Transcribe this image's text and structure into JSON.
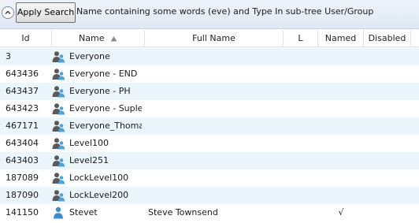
{
  "search": {
    "apply_label": "Apply Search",
    "criteria_text": "Name containing some words (eve) and Type In sub-tree User/Group"
  },
  "columns": {
    "id": "Id",
    "name": "Name",
    "full_name": "Full Name",
    "l": "L",
    "named": "Named",
    "disabled": "Disabled"
  },
  "sort": {
    "column": "Name",
    "direction": "ascending"
  },
  "rows": [
    {
      "id": "3",
      "type": "group",
      "name": "Everyone",
      "full_name": "",
      "named": ""
    },
    {
      "id": "643436",
      "type": "group",
      "name": "Everyone - END",
      "full_name": "",
      "named": ""
    },
    {
      "id": "643437",
      "type": "group",
      "name": "Everyone - PH",
      "full_name": "",
      "named": ""
    },
    {
      "id": "643423",
      "type": "group",
      "name": "Everyone - Suple",
      "full_name": "",
      "named": ""
    },
    {
      "id": "467171",
      "type": "group",
      "name": "Everyone_Thoma",
      "full_name": "",
      "named": ""
    },
    {
      "id": "643404",
      "type": "group",
      "name": "Level100",
      "full_name": "",
      "named": ""
    },
    {
      "id": "643403",
      "type": "group",
      "name": "Level251",
      "full_name": "",
      "named": ""
    },
    {
      "id": "187089",
      "type": "group",
      "name": "LockLevel100",
      "full_name": "",
      "named": ""
    },
    {
      "id": "187090",
      "type": "group",
      "name": "LockLevel200",
      "full_name": "",
      "named": ""
    },
    {
      "id": "141150",
      "type": "user",
      "name": "Stevet",
      "full_name": "Steve Townsend",
      "named": "√"
    }
  ],
  "icons": {
    "collapse": "chevron-up-icon",
    "sort": "sort-ascending-icon",
    "group": "group-icon",
    "user": "user-icon"
  },
  "colors": {
    "row_alt": "#ebf5fc",
    "toolbar_top": "#eef3f9",
    "toolbar_bottom": "#dfe8f3",
    "user_icon": "#3a8fd0",
    "group_icon_dark": "#5a5a5a",
    "group_icon_light": "#4aa3de"
  }
}
